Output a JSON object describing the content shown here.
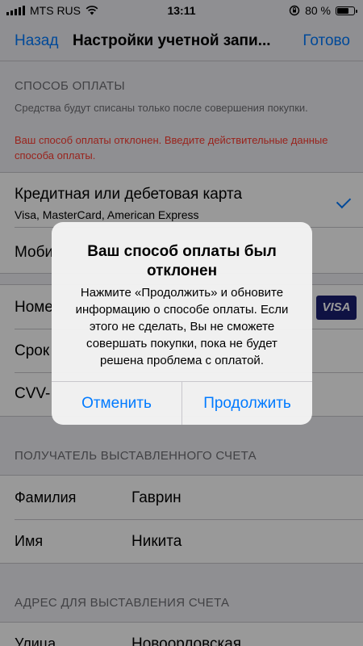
{
  "status_bar": {
    "carrier": "MTS RUS",
    "time": "13:11",
    "battery_percent": "80 %",
    "battery_level": 0.8
  },
  "nav": {
    "back": "Назад",
    "title": "Настройки учетной запи...",
    "done": "Готово"
  },
  "payment_section": {
    "header": "СПОСОБ ОПЛАТЫ",
    "note": "Средства будут списаны только после совершения покупки.",
    "error": "Ваш способ оплаты отклонен. Введите действительные данные способа оплаты.",
    "options": [
      {
        "label": "Кредитная или дебетовая карта",
        "sublabel": "Visa, MasterCard, American Express",
        "selected": true
      },
      {
        "label": "Моби"
      }
    ]
  },
  "card_fields": {
    "number_label": "Номе",
    "expiry_label": "Срок",
    "cvv_label": "CVV-",
    "visa_logo": "VISA"
  },
  "billing_recipient": {
    "header": "ПОЛУЧАТЕЛЬ ВЫСТАВЛЕННОГО СЧЕТА",
    "last_name_label": "Фамилия",
    "last_name_value": "Гаврин",
    "first_name_label": "Имя",
    "first_name_value": "Никита"
  },
  "billing_address": {
    "header": "АДРЕС ДЛЯ ВЫСТАВЛЕНИЯ СЧЕТА",
    "street_label": "Улица",
    "street_value": "Новоорловская"
  },
  "alert": {
    "title": "Ваш способ оплаты был отклонен",
    "message": "Нажмите «Продолжить» и обновите информацию о способе оплаты. Если этого не сделать, Вы не сможете совершать покупки, пока не будет решена проблема с оплатой.",
    "cancel": "Отменить",
    "continue": "Продолжить"
  },
  "colors": {
    "accent": "#007aff",
    "error": "#ff3b30",
    "visa": "#1a1f71"
  }
}
